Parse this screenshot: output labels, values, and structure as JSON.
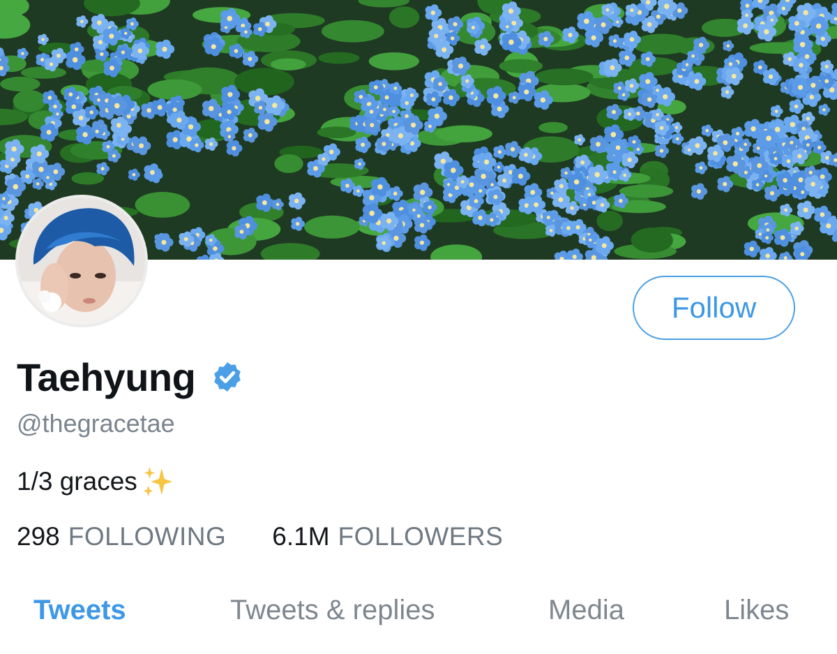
{
  "profile": {
    "display_name": "Taehyung",
    "handle": "@thegracetae",
    "bio": "1/3 graces",
    "verified": true,
    "follow_label": "Follow"
  },
  "stats": {
    "following_count": "298",
    "following_label": "FOLLOWING",
    "followers_count": "6.1M",
    "followers_label": "FOLLOWERS"
  },
  "tabs": [
    {
      "label": "Tweets",
      "active": true
    },
    {
      "label": "Tweets & replies",
      "active": false
    },
    {
      "label": "Media",
      "active": false
    },
    {
      "label": "Likes",
      "active": false
    }
  ],
  "icons": {
    "verified": "verified-badge-icon",
    "bio_emoji": "sparkles-icon"
  },
  "colors": {
    "accent": "#3e98e6",
    "verified": "#4a9fe6",
    "muted_text": "#7b848d",
    "banner_base": "#1f3a22",
    "flower_blue": "#5b9be8"
  }
}
